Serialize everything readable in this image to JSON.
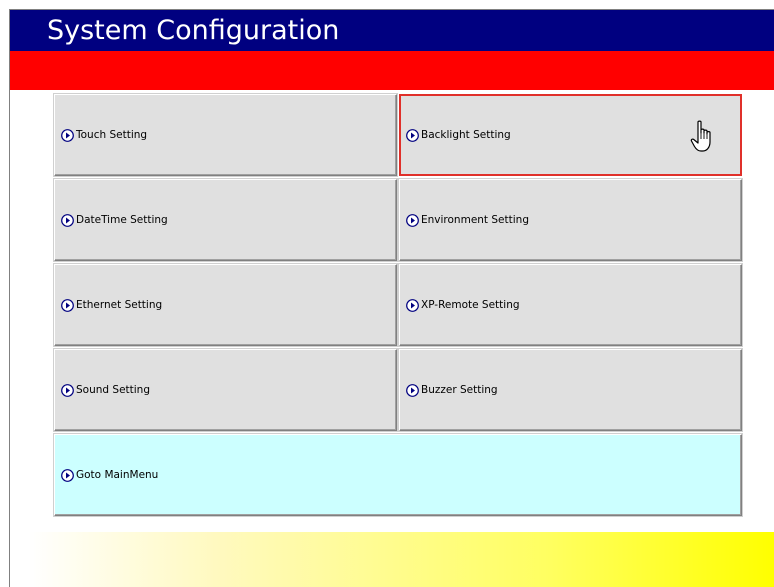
{
  "window": {
    "title": "System Configuration"
  },
  "colors": {
    "title_bar": "#000080",
    "accent_bar": "#ff0000",
    "button_face": "#e0e0e0",
    "main_menu_button": "#ccffff",
    "selected_border": "#e0302a",
    "footer_gradient_end": "#ffff00"
  },
  "menu": {
    "items": [
      {
        "label": "Touch Setting",
        "icon": "arrow-right-circle-icon"
      },
      {
        "label": "Backlight Setting",
        "icon": "arrow-right-circle-icon",
        "selected": true
      },
      {
        "label": "DateTime Setting",
        "icon": "arrow-right-circle-icon"
      },
      {
        "label": "Environment Setting",
        "icon": "arrow-right-circle-icon"
      },
      {
        "label": "Ethernet Setting",
        "icon": "arrow-right-circle-icon"
      },
      {
        "label": "XP-Remote Setting",
        "icon": "arrow-right-circle-icon"
      },
      {
        "label": "Sound Setting",
        "icon": "arrow-right-circle-icon"
      },
      {
        "label": "Buzzer Setting",
        "icon": "arrow-right-circle-icon"
      }
    ],
    "main_menu": {
      "label": "Goto MainMenu",
      "icon": "arrow-right-circle-icon"
    }
  },
  "cursor": {
    "icon": "hand-pointer-icon"
  }
}
